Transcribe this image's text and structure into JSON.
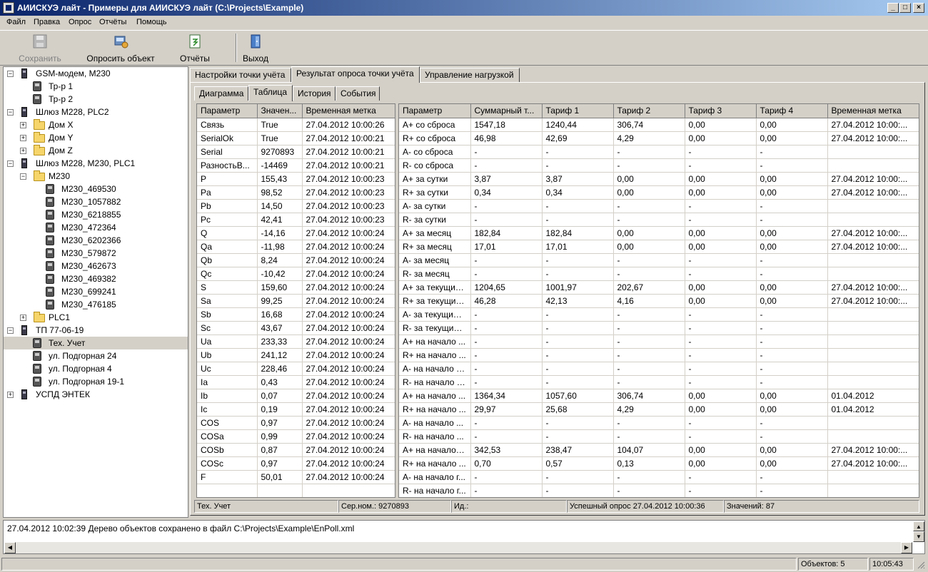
{
  "window": {
    "title": "АИИСКУЭ лайт - Примеры для АИИСКУЭ лайт (C:\\Projects\\Example)",
    "min": "_",
    "max": "□",
    "close": "×"
  },
  "menu": [
    "Файл",
    "Правка",
    "Опрос",
    "Отчёты",
    "Помощь"
  ],
  "toolbar": {
    "save": "Сохранить",
    "poll": "Опросить объект",
    "reports": "Отчёты",
    "exit": "Выход"
  },
  "tree": [
    "GSM-модем, M230",
    "Тр-р 1",
    "Тр-р 2",
    "Шлюз M228, PLC2",
    "Дом X",
    "Дом Y",
    "Дом Z",
    "Шлюз M228, M230, PLC1",
    "M230",
    "M230_469530",
    "M230_1057882",
    "M230_6218855",
    "M230_472364",
    "M230_6202366",
    "M230_579872",
    "M230_462673",
    "M230_469382",
    "M230_699241",
    "M230_476185",
    "PLC1",
    "ТП 77-06-19",
    "Тех. Учет",
    "ул. Подгорная 24",
    "ул. Подгорная 4",
    "ул. Подгорная 19-1",
    "УСПД ЭНТЕК"
  ],
  "tabs_top": [
    "Настройки точки учёта",
    "Результат опроса точки учёта",
    "Управление нагрузкой"
  ],
  "tabs_sub": [
    "Диаграмма",
    "Таблица",
    "История",
    "События"
  ],
  "left_table": {
    "headers": [
      "Параметр",
      "Значен...",
      "Временная метка"
    ],
    "rows": [
      [
        "Связь",
        "True",
        "27.04.2012 10:00:26"
      ],
      [
        "SerialOk",
        "True",
        "27.04.2012 10:00:21"
      ],
      [
        "Serial",
        "9270893",
        "27.04.2012 10:00:21"
      ],
      [
        "РазностьВ...",
        "-14469",
        "27.04.2012 10:00:21"
      ],
      [
        "P",
        "155,43",
        "27.04.2012 10:00:23"
      ],
      [
        "Pa",
        "98,52",
        "27.04.2012 10:00:23"
      ],
      [
        "Pb",
        "14,50",
        "27.04.2012 10:00:23"
      ],
      [
        "Pc",
        "42,41",
        "27.04.2012 10:00:23"
      ],
      [
        "Q",
        "-14,16",
        "27.04.2012 10:00:24"
      ],
      [
        "Qa",
        "-11,98",
        "27.04.2012 10:00:24"
      ],
      [
        "Qb",
        "8,24",
        "27.04.2012 10:00:24"
      ],
      [
        "Qc",
        "-10,42",
        "27.04.2012 10:00:24"
      ],
      [
        "S",
        "159,60",
        "27.04.2012 10:00:24"
      ],
      [
        "Sa",
        "99,25",
        "27.04.2012 10:00:24"
      ],
      [
        "Sb",
        "16,68",
        "27.04.2012 10:00:24"
      ],
      [
        "Sc",
        "43,67",
        "27.04.2012 10:00:24"
      ],
      [
        "Ua",
        "233,33",
        "27.04.2012 10:00:24"
      ],
      [
        "Ub",
        "241,12",
        "27.04.2012 10:00:24"
      ],
      [
        "Uc",
        "228,46",
        "27.04.2012 10:00:24"
      ],
      [
        "Ia",
        "0,43",
        "27.04.2012 10:00:24"
      ],
      [
        "Ib",
        "0,07",
        "27.04.2012 10:00:24"
      ],
      [
        "Ic",
        "0,19",
        "27.04.2012 10:00:24"
      ],
      [
        "COS",
        "0,97",
        "27.04.2012 10:00:24"
      ],
      [
        "COSa",
        "0,99",
        "27.04.2012 10:00:24"
      ],
      [
        "COSb",
        "0,87",
        "27.04.2012 10:00:24"
      ],
      [
        "COSc",
        "0,97",
        "27.04.2012 10:00:24"
      ],
      [
        "F",
        "50,01",
        "27.04.2012 10:00:24"
      ],
      [
        "",
        "",
        ""
      ]
    ]
  },
  "right_table": {
    "headers": [
      "Параметр",
      "Суммарный т...",
      "Тариф 1",
      "Тариф 2",
      "Тариф 3",
      "Тариф 4",
      "Временная метка"
    ],
    "rows": [
      [
        "A+ со сброса",
        "1547,18",
        "1240,44",
        "306,74",
        "0,00",
        "0,00",
        "27.04.2012 10:00:..."
      ],
      [
        "R+ со сброса",
        "46,98",
        "42,69",
        "4,29",
        "0,00",
        "0,00",
        "27.04.2012 10:00:..."
      ],
      [
        "A- со сброса",
        "-",
        "-",
        "-",
        "-",
        "-",
        ""
      ],
      [
        "R- со сброса",
        "-",
        "-",
        "-",
        "-",
        "-",
        ""
      ],
      [
        "A+ за сутки",
        "3,87",
        "3,87",
        "0,00",
        "0,00",
        "0,00",
        "27.04.2012 10:00:..."
      ],
      [
        "R+ за сутки",
        "0,34",
        "0,34",
        "0,00",
        "0,00",
        "0,00",
        "27.04.2012 10:00:..."
      ],
      [
        "A- за сутки",
        "-",
        "-",
        "-",
        "-",
        "-",
        ""
      ],
      [
        "R- за сутки",
        "-",
        "-",
        "-",
        "-",
        "-",
        ""
      ],
      [
        "A+ за месяц",
        "182,84",
        "182,84",
        "0,00",
        "0,00",
        "0,00",
        "27.04.2012 10:00:..."
      ],
      [
        "R+ за месяц",
        "17,01",
        "17,01",
        "0,00",
        "0,00",
        "0,00",
        "27.04.2012 10:00:..."
      ],
      [
        "A- за месяц",
        "-",
        "-",
        "-",
        "-",
        "-",
        ""
      ],
      [
        "R- за месяц",
        "-",
        "-",
        "-",
        "-",
        "-",
        ""
      ],
      [
        "A+ за текущий ...",
        "1204,65",
        "1001,97",
        "202,67",
        "0,00",
        "0,00",
        "27.04.2012 10:00:..."
      ],
      [
        "R+ за текущий ...",
        "46,28",
        "42,13",
        "4,16",
        "0,00",
        "0,00",
        "27.04.2012 10:00:..."
      ],
      [
        "A- за текущий г...",
        "-",
        "-",
        "-",
        "-",
        "-",
        ""
      ],
      [
        "R- за текущий ...",
        "-",
        "-",
        "-",
        "-",
        "-",
        ""
      ],
      [
        "A+ на начало ...",
        "-",
        "-",
        "-",
        "-",
        "-",
        ""
      ],
      [
        "R+ на начало ...",
        "-",
        "-",
        "-",
        "-",
        "-",
        ""
      ],
      [
        "A- на начало с...",
        "-",
        "-",
        "-",
        "-",
        "-",
        ""
      ],
      [
        "R- на начало с...",
        "-",
        "-",
        "-",
        "-",
        "-",
        ""
      ],
      [
        "A+ на начало ...",
        "1364,34",
        "1057,60",
        "306,74",
        "0,00",
        "0,00",
        "01.04.2012"
      ],
      [
        "R+ на начало ...",
        "29,97",
        "25,68",
        "4,29",
        "0,00",
        "0,00",
        "01.04.2012"
      ],
      [
        "A- на начало ...",
        "-",
        "-",
        "-",
        "-",
        "-",
        ""
      ],
      [
        "R- на начало ...",
        "-",
        "-",
        "-",
        "-",
        "-",
        ""
      ],
      [
        "A+ на начало г...",
        "342,53",
        "238,47",
        "104,07",
        "0,00",
        "0,00",
        "27.04.2012 10:00:..."
      ],
      [
        "R+ на начало ...",
        "0,70",
        "0,57",
        "0,13",
        "0,00",
        "0,00",
        "27.04.2012 10:00:..."
      ],
      [
        "A- на начало г...",
        "-",
        "-",
        "-",
        "-",
        "-",
        ""
      ],
      [
        "R- на начало г...",
        "-",
        "-",
        "-",
        "-",
        "-",
        ""
      ]
    ]
  },
  "panel_status": [
    "Тех. Учет",
    "Сер.ном.: 9270893",
    "Ид.:",
    "Успешный опрос 27.04.2012 10:00:36",
    "Значений: 87"
  ],
  "log": "27.04.2012 10:02:39  Дерево объектов сохранено в файл C:\\Projects\\Example\\EnPoll.xml",
  "status": {
    "objects": "Объектов: 5",
    "time": "10:05:43"
  }
}
